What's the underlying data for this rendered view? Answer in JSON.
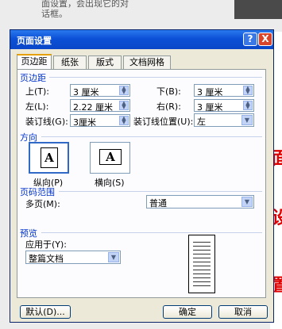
{
  "background": {
    "text_lines": [
      "面设置，会出现它的对",
      "话框。"
    ],
    "accent_chars": [
      "面",
      "设",
      "置"
    ],
    "colors": {
      "red": "#dd0000"
    }
  },
  "dialog": {
    "title": "页面设置",
    "help_label": "?",
    "close_label": "X",
    "tabs": [
      "页边距",
      "纸张",
      "版式",
      "文档网格"
    ],
    "margins": {
      "section": "页边距",
      "top_label": "上(T):",
      "top_value": "3 厘米",
      "bottom_label": "下(B):",
      "bottom_value": "3 厘米",
      "left_label": "左(L):",
      "left_value": "2.22 厘米",
      "right_label": "右(R):",
      "right_value": "3 厘米",
      "gutter_label": "装订线(G):",
      "gutter_value": "3厘米",
      "gutter_pos_label": "装订线位置(U):",
      "gutter_pos_value": "左"
    },
    "orientation": {
      "section": "方向",
      "portrait_label": "纵向(P)",
      "landscape_label": "横向(S)",
      "glyph": "A"
    },
    "pages": {
      "section": "页码范围",
      "multiple_label": "多页(M):",
      "multiple_value": "普通"
    },
    "preview": {
      "section": "预览",
      "apply_label": "应用于(Y):",
      "apply_value": "整篇文档"
    },
    "buttons": {
      "default": "默认(D)...",
      "ok": "确定",
      "cancel": "取消"
    }
  }
}
